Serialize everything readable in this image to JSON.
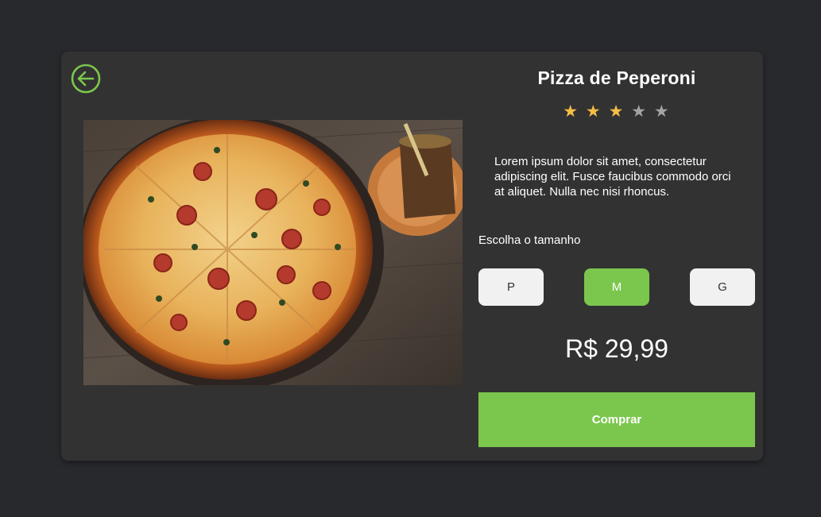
{
  "product": {
    "title": "Pizza de Peperoni",
    "rating": 3,
    "rating_max": 5,
    "description": "Lorem ipsum dolor sit amet, consectetur adipiscing elit. Fusce faucibus commodo orci at aliquet. Nulla nec nisi rhoncus.",
    "image_icon": "pizza-photo",
    "price": "R$ 29,99"
  },
  "sizes": {
    "label": "Escolha o tamanho",
    "options": [
      "P",
      "M",
      "G"
    ],
    "selected": "M"
  },
  "actions": {
    "buy_label": "Comprar",
    "back_icon": "arrow-left-circle-icon"
  },
  "colors": {
    "accent": "#7bc74d",
    "star_on": "#f5bd45",
    "star_off": "#a3a3a3",
    "card": "#323232",
    "background": "#27292d"
  }
}
